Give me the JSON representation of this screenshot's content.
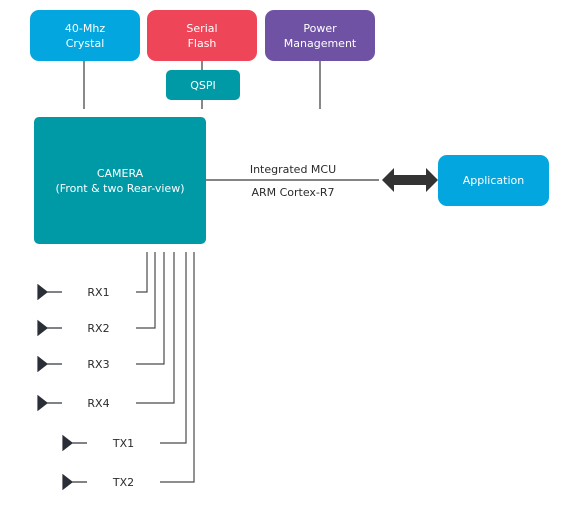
{
  "top_components": {
    "crystal": "40-Mhz\nCrystal",
    "flash": "Serial\nFlash",
    "power": "Power\nManagement"
  },
  "interface": {
    "qspi": "QSPI"
  },
  "soc": {
    "camera": "CAMERA\n(Front & two Rear-view)",
    "mcu_title": "Integrated MCU",
    "mcu_core": "ARM Cortex-R7"
  },
  "external": {
    "application": "Application"
  },
  "rf_chains": {
    "receivers": [
      "RX1",
      "RX2",
      "RX3",
      "RX4"
    ],
    "transmitters": [
      "TX1",
      "TX2"
    ]
  },
  "colors": {
    "cyan": "#03a6de",
    "red": "#ef4559",
    "purple": "#6f52a3",
    "teal": "#009aa6",
    "panel_gray": "#dfdbd7",
    "rf_panel": "#f2f2f1",
    "line": "#3a3a3a"
  }
}
